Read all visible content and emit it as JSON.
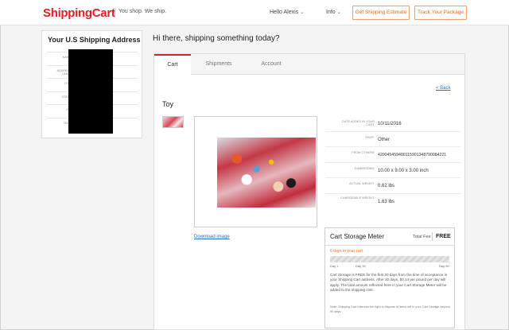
{
  "header": {
    "logo": "ShippingCart",
    "tagline": "You shop. We ship.",
    "user_menu": "Hello Alexis",
    "info_menu": "Info",
    "estimate_button": "Get Shipping Estimate",
    "track_button": "Track Your Package"
  },
  "address_panel": {
    "title": "Your U.S Shipping Address",
    "labels": [
      "NAME",
      "ADDRESS LINE 1",
      "CITY",
      "STATE",
      "ZIP",
      "TEL #"
    ]
  },
  "greeting": "Hi there, shipping something today?",
  "tabs": [
    {
      "label": "Cart",
      "active": true
    },
    {
      "label": "Shipments",
      "active": false
    },
    {
      "label": "Account",
      "active": false
    }
  ],
  "back_link": "< Back",
  "item": {
    "title": "Toy",
    "download_label": "Download image",
    "details": [
      {
        "label": "DATE ADDED IN YOUR CART:",
        "value": "10/11/2016"
      },
      {
        "label": "SHOP:",
        "value": "Other"
      },
      {
        "label": "FROM OTHER#:",
        "value": "420045459400115901348790084221"
      },
      {
        "label": "DIMENSIONS:",
        "value": "10.00 x 9.00 x 3.00 inch"
      },
      {
        "label": "ACTUAL WEIGHT:",
        "value": "0.62 lbs"
      },
      {
        "label": "CHARGEABLE WEIGHT:",
        "value": "1.63 lbs"
      }
    ]
  },
  "storage_meter": {
    "title": "Cart Storage Meter",
    "fee_label": "Total Fee",
    "fee_value": "FREE",
    "days_text": "0 days in your cart",
    "days_in_cart": 0,
    "max_days": 90,
    "ticks": [
      "Day 1",
      "Day 30",
      "Day 90"
    ],
    "description": "Cart Storage is FREE for the first 30 days from the time of acceptance in your Shipping Cart address. After 30 days, $0.14 per pound per day will apply. The total amount reflected here in your Cart Storage Meter will be added to the shipping cost.",
    "note": "Note: Shipping Cart reserves the right to dispose of items left in your Cart Storage beyond 90 days."
  },
  "colors": {
    "brand_red": "#e31e24",
    "accent_orange": "#e86b1f",
    "link_blue": "#2a6ebb"
  }
}
